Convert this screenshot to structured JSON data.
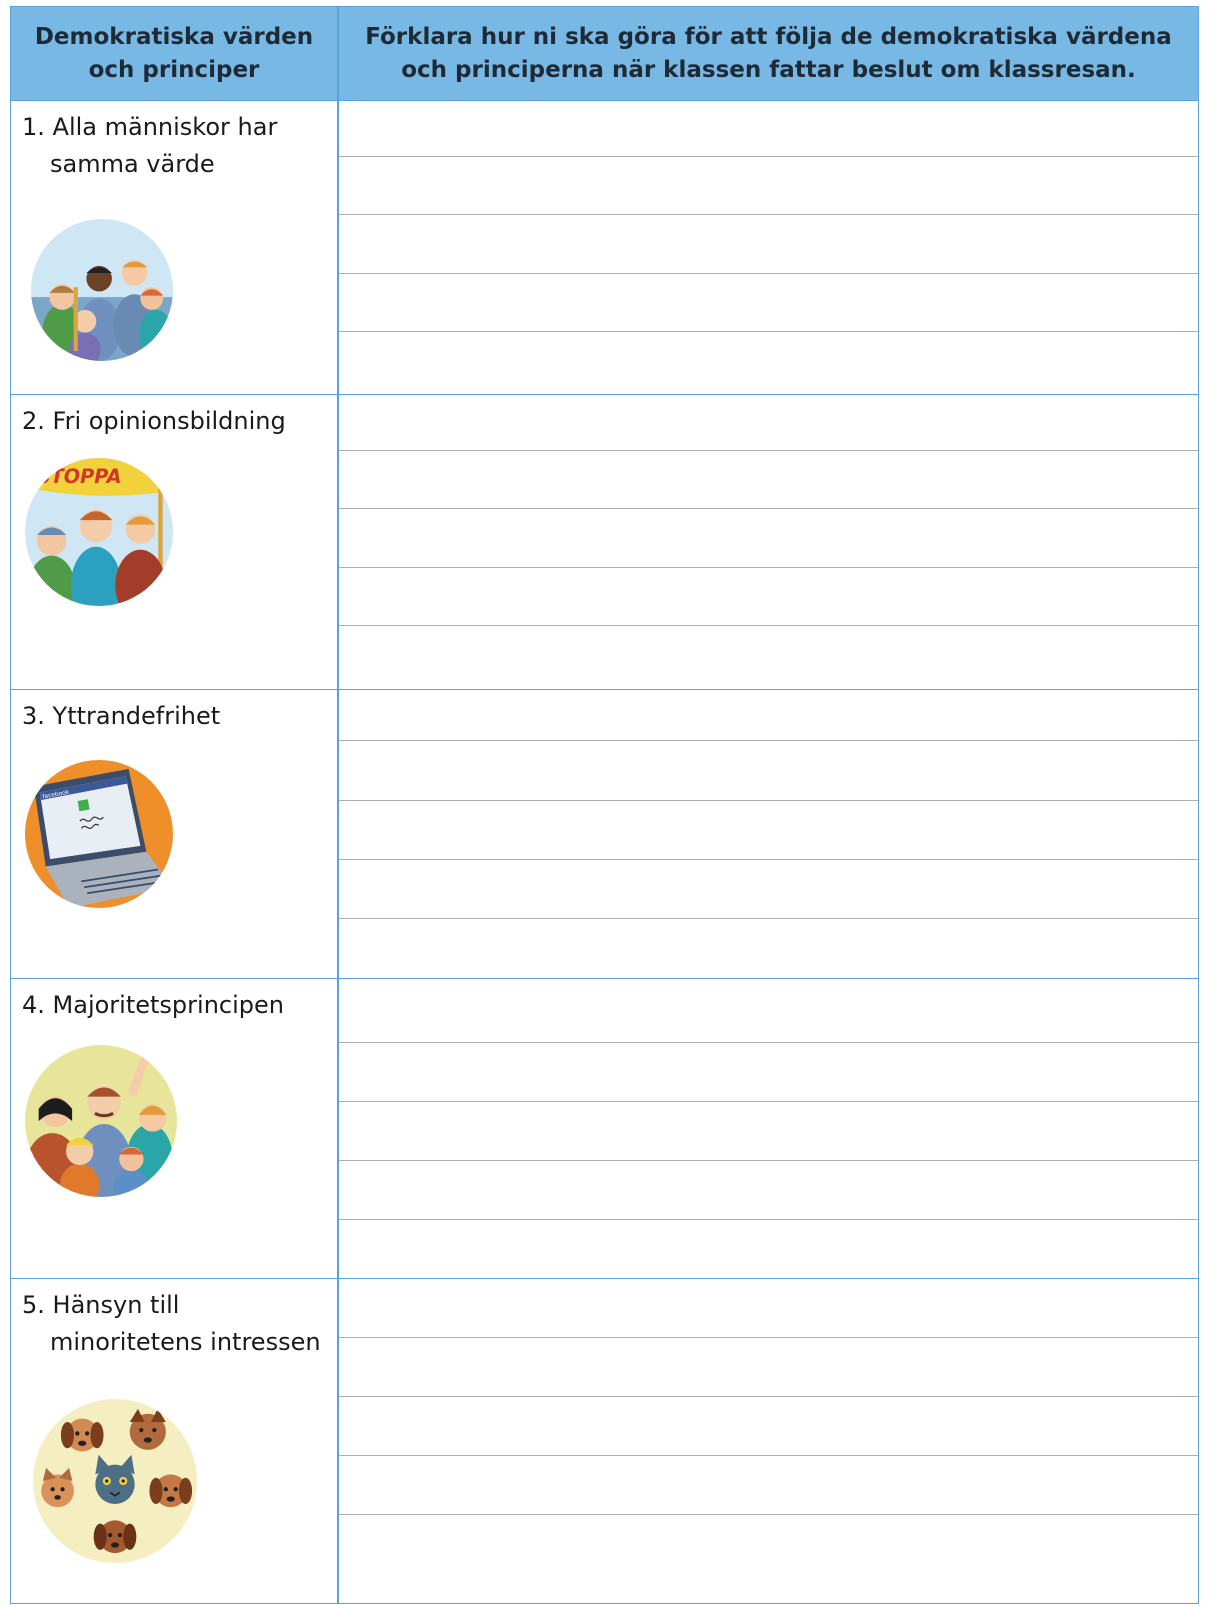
{
  "header": {
    "left_line1": "Demokratiska värden",
    "left_line2": "och principer",
    "right_line1": "Förklara hur ni ska göra för att följa de demokratiska värdena",
    "right_line2": "och principerna när klassen fattar beslut om klassresan."
  },
  "rows": [
    {
      "line1": "1.  Alla människor har",
      "line2": "samma värde",
      "icon": "group-of-people-icon"
    },
    {
      "line1": "2.  Fri opinionsbildning",
      "line2": "",
      "icon": "protest-banner-icon",
      "banner_text": "STOPPA"
    },
    {
      "line1": "3.  Yttrandefrihet",
      "line2": "",
      "icon": "laptop-icon",
      "screen_logo": "facebook"
    },
    {
      "line1": "4.  Majoritetsprincipen",
      "line2": "",
      "icon": "voting-hands-icon"
    },
    {
      "line1": "5. Hänsyn till",
      "line2": "minoritetens intressen",
      "icon": "dogs-and-cat-icon"
    }
  ],
  "colors": {
    "header_bg": "#78b8e4",
    "border": "#5aa3d6",
    "write_line": "#a8aeb4"
  }
}
